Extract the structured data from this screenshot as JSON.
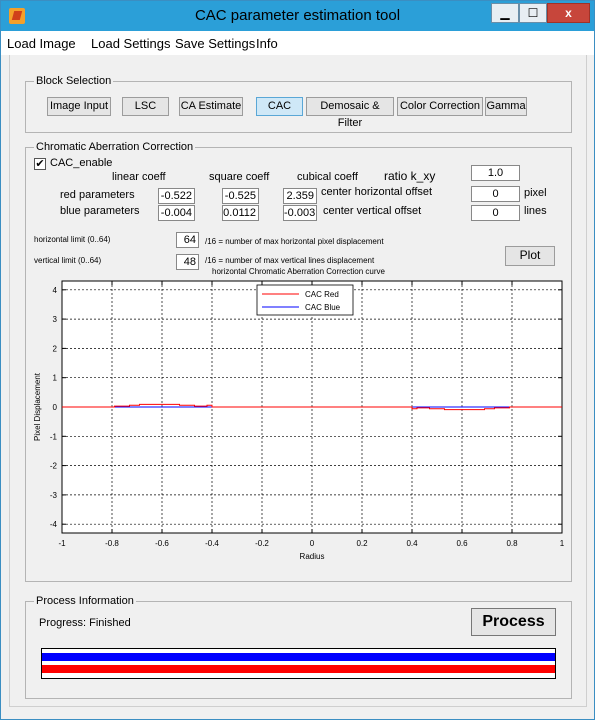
{
  "window": {
    "title": "CAC parameter estimation tool"
  },
  "titlebar_buttons": {
    "minimize": "▁",
    "maximize": "☐",
    "close": "x"
  },
  "menu": [
    "Load Image",
    "Load Settings",
    "Save Settings",
    "Info"
  ],
  "block_selection": {
    "legend": "Block Selection",
    "buttons": [
      "Image Input",
      "LSC",
      "CA Estimate",
      "CAC",
      "Demosaic & Filter",
      "Color Correction",
      "Gamma"
    ],
    "active": "CAC"
  },
  "cac": {
    "legend": "Chromatic Aberration Correction",
    "enable_label": "CAC_enable",
    "enable_checked": "✔",
    "headers": {
      "linear": "linear coeff",
      "square": "square coeff",
      "cubic": "cubical coeff"
    },
    "red_label": "red parameters",
    "blue_label": "blue parameters",
    "red": {
      "linear": "-0.522",
      "square": "-0.525",
      "cubic": "2.359"
    },
    "blue": {
      "linear": "-0.004",
      "square": "0.0112",
      "cubic": "-0.003"
    },
    "ratio_label": "ratio k_xy",
    "ratio_value": "1.0",
    "h_offset_label": "center horizontal offset",
    "h_offset_value": "0",
    "h_offset_unit": "pixel",
    "v_offset_label": "center vertical  offset",
    "v_offset_value": "0",
    "v_offset_unit": "lines",
    "h_limit_label": "horizontal limit (0..64)",
    "h_limit_value": "64",
    "h_limit_desc": "/16 = number of max horizontal pixel displacement",
    "v_limit_label": "vertical  limit   (0..64)",
    "v_limit_value": "48",
    "v_limit_desc": "/16 = number of max vertical lines displacement",
    "plot_button": "Plot"
  },
  "chart_data": {
    "type": "line",
    "title": "horizontal Chromatic Aberration Correction curve",
    "xlabel": "Radius",
    "ylabel": "Pixel Displacement",
    "xlim": [
      -1,
      1
    ],
    "ylim": [
      -4.3,
      4.3
    ],
    "xticks": [
      -1,
      -0.8,
      -0.6,
      -0.4,
      -0.2,
      0,
      0.2,
      0.4,
      0.6,
      0.8,
      1
    ],
    "xtick_labels": [
      "-1",
      "-0.8",
      "-0.6",
      "-0.4",
      "-0.2",
      "0",
      "0.2",
      "0.4",
      "0.6",
      "0.8",
      "1"
    ],
    "yticks": [
      4,
      3,
      2,
      1,
      0,
      -1,
      -2,
      -3,
      -4
    ],
    "ytick_labels": [
      "4",
      "3",
      "2",
      "1",
      "0",
      "-1",
      "-2",
      "-3",
      "-4"
    ],
    "grid": true,
    "legend_position": "top-center",
    "series": [
      {
        "name": "CAC Red",
        "color": "#ff0000",
        "x": [
          -1,
          -0.79,
          -0.79,
          -0.73,
          -0.73,
          -0.69,
          -0.69,
          -0.53,
          -0.53,
          -0.47,
          -0.47,
          -0.42,
          -0.42,
          -0.4,
          -0.4,
          0.4,
          0.4,
          0.42,
          0.42,
          0.47,
          0.47,
          0.53,
          0.53,
          0.69,
          0.69,
          0.73,
          0.73,
          0.79,
          0.79,
          1
        ],
        "y": [
          0,
          0,
          0.03,
          0.03,
          0.06,
          0.06,
          0.09,
          0.09,
          0.06,
          0.06,
          0.03,
          0.03,
          0.06,
          0.06,
          0,
          0,
          -0.06,
          -0.06,
          -0.03,
          -0.03,
          -0.06,
          -0.06,
          -0.09,
          -0.09,
          -0.06,
          -0.06,
          -0.03,
          -0.03,
          0,
          0
        ]
      },
      {
        "name": "CAC Blue",
        "color": "#0000ff",
        "x": [
          -1,
          1
        ],
        "y": [
          0,
          0
        ]
      }
    ]
  },
  "process": {
    "legend": "Process Information",
    "progress_label": "Progress: Finished",
    "button": "Process",
    "progress": 1.0,
    "bar_colors": [
      "#0000ff",
      "#ff0000"
    ]
  }
}
